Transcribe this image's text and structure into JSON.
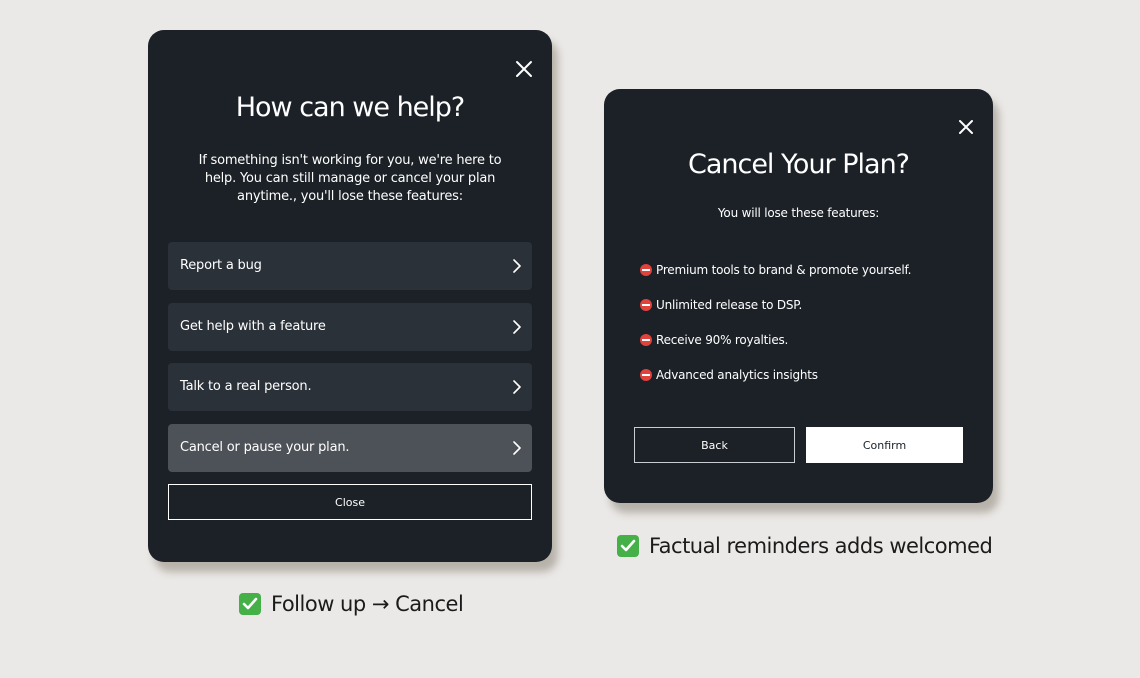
{
  "help_modal": {
    "title": "How can we help?",
    "description": "If something isn't working for you, we're here to help. You can still manage or cancel your plan anytime., you'll lose these features:",
    "options": [
      {
        "label": "Report a bug",
        "icon": "chevron-right-icon"
      },
      {
        "label": "Get help with a feature",
        "icon": "chevron-right-icon"
      },
      {
        "label": "Talk to a real person.",
        "icon": "chevron-right-icon"
      },
      {
        "label": "Cancel or pause your plan.",
        "icon": "chevron-right-icon",
        "selected": true
      }
    ],
    "close_label": "Close",
    "close_icon": "close-icon"
  },
  "cancel_modal": {
    "title": "Cancel Your Plan?",
    "subtitle": "You will lose these features:",
    "features": [
      {
        "text": "Premium tools to brand & promote yourself.",
        "icon": "no-entry-icon"
      },
      {
        "text": "Unlimited release to DSP.",
        "icon": "no-entry-icon"
      },
      {
        "text": "Receive 90% royalties.",
        "icon": "no-entry-icon"
      },
      {
        "text": "Advanced analytics insights",
        "icon": "no-entry-icon"
      }
    ],
    "back_label": "Back",
    "confirm_label": "Confirm",
    "close_icon": "close-icon"
  },
  "captions": {
    "left": "Follow up → Cancel",
    "right": "Factual reminders adds welcomed",
    "icon": "check-mark-icon"
  },
  "colors": {
    "background": "#ebe9e7",
    "card": "#1b2127",
    "option": "#2b3139",
    "option_selected": "#4d5258",
    "check_green": "#44b047",
    "no_entry_red": "#e0423c"
  }
}
